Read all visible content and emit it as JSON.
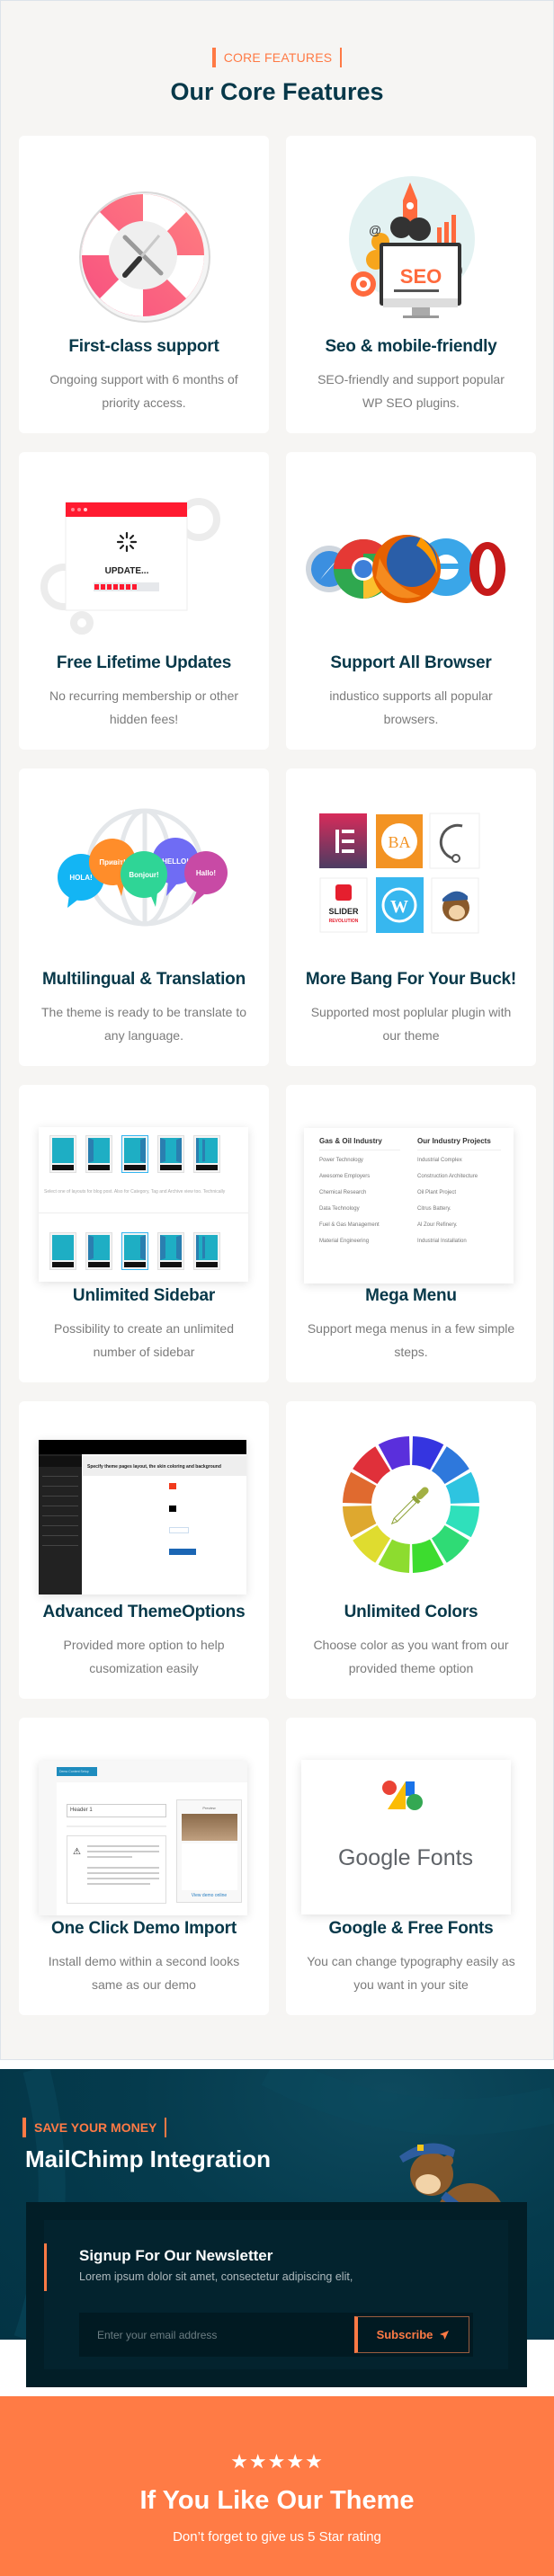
{
  "features": {
    "eyebrow": "CORE FEATURES",
    "title": "Our Core Features",
    "cards": [
      {
        "title": "First-class support",
        "desc": "Ongoing support with 6 months of priority access.",
        "image": "lifebuoy-tools-icon"
      },
      {
        "title": "Seo & mobile-friendly",
        "desc": "SEO-friendly and support popular WP SEO plugins.",
        "image": "seo-monitor-icon",
        "image_text": "SEO"
      },
      {
        "title": "Free Lifetime Updates",
        "desc": "No recurring membership or other hidden fees!",
        "image": "update-window-icon",
        "image_text": "UPDATE...",
        "progress_segments_filled": 7
      },
      {
        "title": "Support All Browser",
        "desc": "industico supports all popular browsers.",
        "image": "browser-logos"
      },
      {
        "title": "Multilingual & Translation",
        "desc": "The theme is ready to be translate to any language.",
        "image": "speech-bubbles-globe",
        "bubbles": [
          "HOLA!",
          "Привіт!",
          "Bonjour!",
          "HELLO!",
          "Hallo!"
        ]
      },
      {
        "title": "More Bang For Your Buck!",
        "desc": "Supported most poplular plugin with our theme",
        "image": "plugin-logos",
        "plugin_labels": [
          "SLIDER",
          "REVOLUTION"
        ]
      },
      {
        "title": "Unlimited Sidebar",
        "desc": "Possibility to create an unlimited number of sidebar",
        "image": "sidebar-layouts",
        "caption": "Select one of layouts for blog post. Also for Category, Tag and Archive view too. Technically"
      },
      {
        "title": "Mega Menu",
        "desc": "Support mega menus in a few simple steps.",
        "image": "mega-menu-preview",
        "menu": {
          "columns": [
            {
              "heading": "Gas & Oil Industry",
              "items": [
                "Power Technology",
                "Awesome Employers",
                "Chemical Research",
                "Data Technology",
                "Fuel & Gas Management",
                "Material Engineering"
              ]
            },
            {
              "heading": "Our Industry Projects",
              "items": [
                "Industrial Complex",
                "Construction Architecture",
                "Oil Plant Project",
                "Citrus Battery.",
                "Al Zour Refinery.",
                "Industrial Installation"
              ]
            }
          ]
        }
      },
      {
        "title": "Advanced ThemeOptions",
        "desc": "Provided more option to help cusomization easily",
        "image": "theme-options-screenshot",
        "header_text": "Specify theme pages layout, the skin coloring and background"
      },
      {
        "title": "Unlimited Colors",
        "desc": "Choose color as you want from our provided theme option",
        "image": "color-wheel-dropper"
      },
      {
        "title": "One Click Demo Import",
        "desc": "Install demo within a second looks same as our demo",
        "image": "demo-import-screenshot",
        "select_value": "Header 1",
        "button_text": "Demo Content Setup",
        "preview_label": "Preview",
        "link_text": "View demo online"
      },
      {
        "title": "Google & Free Fonts",
        "desc": "You can change typography easily as you want in your site",
        "image": "google-fonts-logo",
        "logo_text": "Google Fonts"
      }
    ]
  },
  "mailchimp": {
    "eyebrow": "SAVE YOUR MONEY",
    "title": "MailChimp Integration",
    "newsletter": {
      "title": "Signup For Our Newsletter",
      "desc": "Lorem ipsum dolor sit amet, consectetur adipiscing elit,",
      "email_placeholder": "Enter your email address",
      "email_value": "",
      "subscribe_label": "Subscribe"
    },
    "mascot": "mailchimp-monkey"
  },
  "rating": {
    "stars": "★★★★★",
    "star_count": 5,
    "title": "If You Like Our Theme",
    "subtitle": "Don’t forget to give us 5 Star rating"
  },
  "colors": {
    "accent": "#ff7a45",
    "heading": "#073849",
    "body_text": "#7b7b7b",
    "section_bg": "#f6f5f3",
    "dark_teal": "#053b4d",
    "newsletter_bg": "#021e27"
  }
}
